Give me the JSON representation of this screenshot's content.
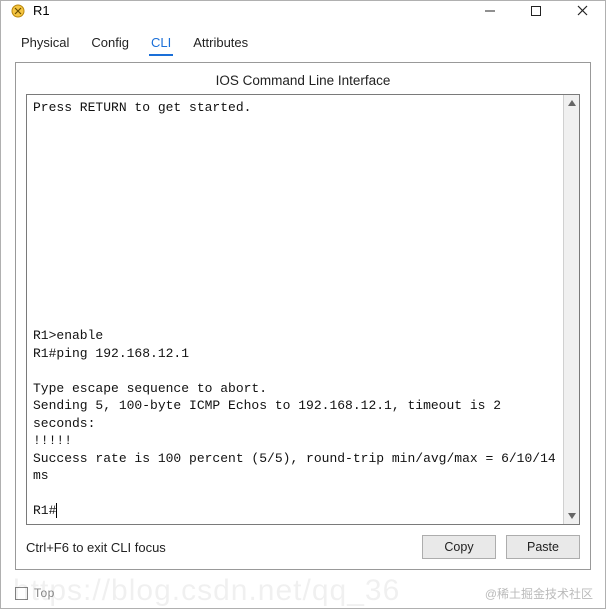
{
  "window": {
    "title": "R1"
  },
  "tabs": [
    {
      "label": "Physical",
      "active": false
    },
    {
      "label": "Config",
      "active": false
    },
    {
      "label": "CLI",
      "active": true
    },
    {
      "label": "Attributes",
      "active": false
    }
  ],
  "panel": {
    "title": "IOS Command Line Interface",
    "terminal_lines": [
      "Press RETURN to get started.",
      "",
      "",
      "",
      "",
      "",
      "",
      "",
      "",
      "",
      "",
      "",
      "",
      "R1>enable",
      "R1#ping 192.168.12.1",
      "",
      "Type escape sequence to abort.",
      "Sending 5, 100-byte ICMP Echos to 192.168.12.1, timeout is 2 seconds:",
      "!!!!!",
      "Success rate is 100 percent (5/5), round-trip min/avg/max = 6/10/14 ms",
      "",
      "R1#"
    ],
    "hint": "Ctrl+F6 to exit CLI focus",
    "copy_label": "Copy",
    "paste_label": "Paste"
  },
  "footer": {
    "checkbox_label": "Top"
  },
  "watermark": {
    "main": "@稀土掘金技术社区",
    "bg": "https://blog.csdn.net/qq_36"
  }
}
